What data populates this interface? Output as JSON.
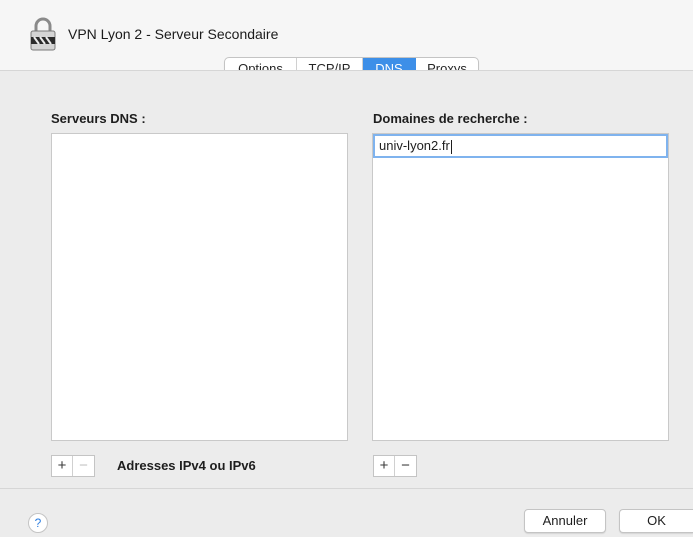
{
  "window": {
    "title": "VPN Lyon 2 - Serveur Secondaire",
    "icon": "vpn-lock-icon"
  },
  "tabs": [
    {
      "label": "Options",
      "active": false
    },
    {
      "label": "TCP/IP",
      "active": false
    },
    {
      "label": "DNS",
      "active": true
    },
    {
      "label": "Proxys",
      "active": false
    }
  ],
  "dns_servers": {
    "label": "Serveurs DNS :",
    "items": [],
    "add_label": "+",
    "remove_label": "−",
    "hint": "Adresses IPv4 ou IPv6"
  },
  "search_domains": {
    "label": "Domaines de recherche :",
    "items": [
      "univ-lyon2.fr"
    ],
    "add_label": "+",
    "remove_label": "−"
  },
  "footer": {
    "help_label": "?",
    "cancel_label": "Annuler",
    "ok_label": "OK"
  },
  "colors": {
    "accent": "#3d8fe8",
    "focus_ring": "#7fb3ee",
    "background": "#ececec"
  }
}
